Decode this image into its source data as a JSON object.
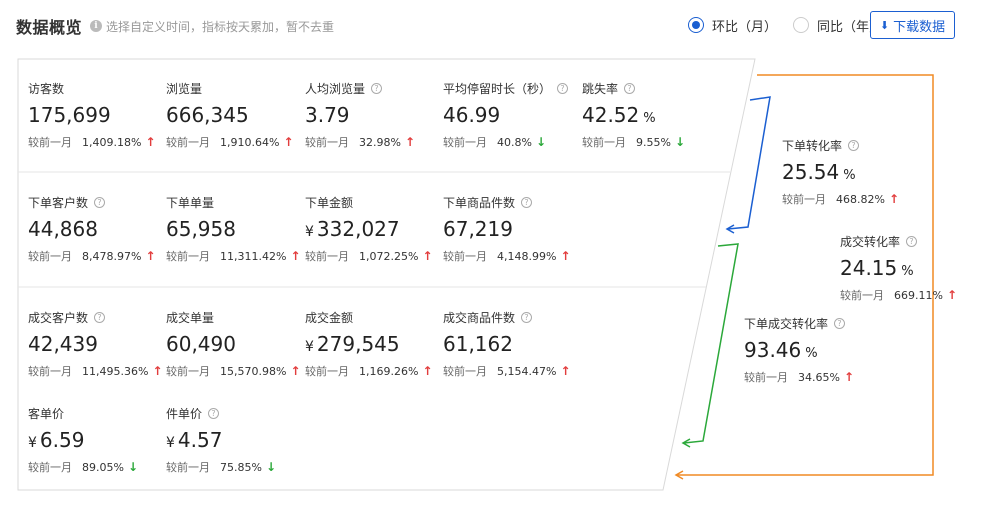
{
  "header": {
    "title": "数据概览",
    "hint": "选择自定义时间，指标按天累加，暂不去重"
  },
  "compare_mode": {
    "options": [
      {
        "label": "环比（月）",
        "checked": true
      },
      {
        "label": "同比（年）",
        "checked": false
      }
    ]
  },
  "download_label": "下载数据",
  "compare_prefix": "较前一月",
  "rows": [
    [
      {
        "key": "visitors",
        "label": "访客数",
        "help": false,
        "prefix": "",
        "value": "175,699",
        "suffix": "",
        "pct": "1,409.18%",
        "trend": "up"
      },
      {
        "key": "pageviews",
        "label": "浏览量",
        "help": false,
        "prefix": "",
        "value": "666,345",
        "suffix": "",
        "pct": "1,910.64%",
        "trend": "up"
      },
      {
        "key": "pv-per-visitor",
        "label": "人均浏览量",
        "help": true,
        "prefix": "",
        "value": "3.79",
        "suffix": "",
        "pct": "32.98%",
        "trend": "up"
      },
      {
        "key": "avg-stay",
        "label": "平均停留时长（秒）",
        "help": true,
        "prefix": "",
        "value": "46.99",
        "suffix": "",
        "pct": "40.8%",
        "trend": "down"
      },
      {
        "key": "bounce-rate",
        "label": "跳失率",
        "help": true,
        "prefix": "",
        "value": "42.52",
        "suffix": "%",
        "pct": "9.55%",
        "trend": "down"
      }
    ],
    [
      {
        "key": "order-customers",
        "label": "下单客户数",
        "help": true,
        "prefix": "",
        "value": "44,868",
        "suffix": "",
        "pct": "8,478.97%",
        "trend": "up"
      },
      {
        "key": "order-count",
        "label": "下单单量",
        "help": false,
        "prefix": "",
        "value": "65,958",
        "suffix": "",
        "pct": "11,311.42%",
        "trend": "up"
      },
      {
        "key": "order-amount",
        "label": "下单金额",
        "help": false,
        "prefix": "¥",
        "value": "332,027",
        "suffix": "",
        "pct": "1,072.25%",
        "trend": "up"
      },
      {
        "key": "order-items",
        "label": "下单商品件数",
        "help": true,
        "prefix": "",
        "value": "67,219",
        "suffix": "",
        "pct": "4,148.99%",
        "trend": "up"
      }
    ],
    [
      {
        "key": "deal-customers",
        "label": "成交客户数",
        "help": true,
        "prefix": "",
        "value": "42,439",
        "suffix": "",
        "pct": "11,495.36%",
        "trend": "up"
      },
      {
        "key": "deal-count",
        "label": "成交单量",
        "help": false,
        "prefix": "",
        "value": "60,490",
        "suffix": "",
        "pct": "15,570.98%",
        "trend": "up"
      },
      {
        "key": "deal-amount",
        "label": "成交金额",
        "help": false,
        "prefix": "¥",
        "value": "279,545",
        "suffix": "",
        "pct": "1,169.26%",
        "trend": "up"
      },
      {
        "key": "deal-items",
        "label": "成交商品件数",
        "help": true,
        "prefix": "",
        "value": "61,162",
        "suffix": "",
        "pct": "5,154.47%",
        "trend": "up"
      }
    ],
    [
      {
        "key": "avg-order-price",
        "label": "客单价",
        "help": false,
        "prefix": "¥",
        "value": "6.59",
        "suffix": "",
        "pct": "89.05%",
        "trend": "down"
      },
      {
        "key": "avg-item-price",
        "label": "件单价",
        "help": true,
        "prefix": "",
        "value": "4.57",
        "suffix": "",
        "pct": "75.85%",
        "trend": "down",
        "prefix2": "¥"
      }
    ]
  ],
  "conversions": [
    {
      "key": "order-conversion",
      "label": "下单转化率",
      "help": true,
      "value": "25.54",
      "suffix": "%",
      "pct": "468.82%",
      "trend": "up"
    },
    {
      "key": "deal-conversion",
      "label": "成交转化率",
      "help": true,
      "value": "24.15",
      "suffix": "%",
      "pct": "669.11%",
      "trend": "up"
    },
    {
      "key": "order-to-deal-conversion",
      "label": "下单成交转化率",
      "help": true,
      "value": "93.46",
      "suffix": "%",
      "pct": "34.65%",
      "trend": "down-as-up"
    }
  ],
  "colors": {
    "accent": "#1b5fd1",
    "up": "#e23d3d",
    "down": "#2ba83a",
    "flow_blue": "#1b5fd1",
    "flow_green": "#2ba83a",
    "flow_orange": "#f08a24"
  }
}
